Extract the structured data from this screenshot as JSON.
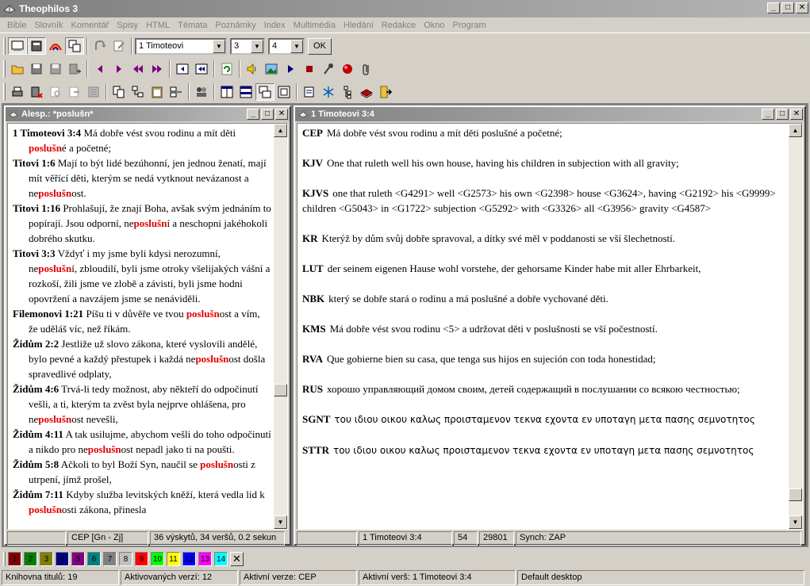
{
  "window": {
    "title": "Theophilos 3"
  },
  "menu": [
    "Bible",
    "Slovník",
    "Komentář",
    "Spisy",
    "HTML",
    "Témata",
    "Poznámky",
    "Index",
    "Multimédia",
    "Hledání",
    "Redakce",
    "Okno",
    "Program"
  ],
  "toolbar": {
    "book_select": "1 Timoteovi",
    "chapter_select": "3",
    "verse_select": "4",
    "ok_label": "OK"
  },
  "search_window": {
    "title": "Alesp.: *poslušn*",
    "results": [
      {
        "ref": "1 Timoteovi 3:4",
        "parts": [
          "  Má dobře vést svou rodinu a mít děti ",
          "poslušn",
          "é a početné;"
        ]
      },
      {
        "ref": "Titovi 1:6",
        "parts": [
          "  Mají to být lidé bezúhonní, jen jednou ženatí, mají mít věřící děti, kterým se nedá vytknout nevázanost a ne",
          "poslušn",
          "ost."
        ]
      },
      {
        "ref": "Titovi 1:16",
        "parts": [
          "  Prohlašují, že znají Boha, avšak svým jednáním to popírají. Jsou odporní, ne",
          "poslušn",
          "í a neschopni jakéhokoli dobrého skutku."
        ]
      },
      {
        "ref": "Titovi 3:3",
        "parts": [
          "  Vždyť i my jsme byli kdysi nerozumní, ne",
          "poslušn",
          "í, zbloudilí, byli jsme otroky všelijakých vášní a rozkoší, žili jsme ve zlobě a závisti, byli jsme hodni opovržení a navzájem jsme se nenáviděli."
        ]
      },
      {
        "ref": "Filemonovi 1:21",
        "parts": [
          "  Píšu ti v důvěře ve tvou ",
          "poslušn",
          "ost a vím, že uděláš víc, než říkám."
        ]
      },
      {
        "ref": "Židům 2:2",
        "parts": [
          "  Jestliže už slovo zákona, které vyslovili andělé, bylo pevné a každý přestupek i každá ne",
          "poslušn",
          "ost došla spravedlivé odplaty,"
        ]
      },
      {
        "ref": "Židům 4:6",
        "parts": [
          "  Trvá-li tedy možnost, aby někteří do odpočinutí vešli, a ti, kterým ta zvěst byla nejprve ohlášena, pro ne",
          "poslušn",
          "ost nevešli,"
        ]
      },
      {
        "ref": "Židům 4:11",
        "parts": [
          "  A tak usilujme, abychom vešli do toho odpočinutí a nikdo pro ne",
          "poslušn",
          "ost nepadl jako ti na poušti."
        ]
      },
      {
        "ref": "Židům 5:8",
        "parts": [
          "  Ačkoli to byl Boží Syn, naučil se ",
          "poslušn",
          "osti z utrpení, jímž prošel,"
        ]
      },
      {
        "ref": "Židům 7:11",
        "parts": [
          "  Kdyby služba levitských kněží, která vedla lid k ",
          "poslušn",
          "osti zákona, přinesla"
        ]
      }
    ],
    "status": [
      "",
      "CEP [Gn - Zj]",
      "36 výskytů, 34 veršů, 0.2 sekun"
    ]
  },
  "verse_window": {
    "title": "1 Timoteovi 3:4",
    "verses": [
      {
        "tr": "CEP",
        "txt": "Má dobře vést svou rodinu a mít děti poslušné a početné;"
      },
      {
        "tr": "KJV",
        "txt": "One that ruleth well his own house, having his children in subjection with all gravity;"
      },
      {
        "tr": "KJVS",
        "txt": "one that ruleth <G4291> well <G2573> his own <G2398> house <G3624>, having <G2192> his <G9999> children <G5043> in <G1722> subjection <G5292> with <G3326> all <G3956> gravity <G4587>"
      },
      {
        "tr": "KR",
        "txt": "Kterýž by dům svůj dobře spravoval, a dítky své měl v poddanosti se vší šlechetností."
      },
      {
        "tr": "LUT",
        "txt": "der seinem eigenen Hause wohl vorstehe, der gehorsame Kinder habe mit aller Ehrbarkeit,"
      },
      {
        "tr": "NBK",
        "txt": "který se dobře stará o rodinu a má poslušné a dobře vychované děti."
      },
      {
        "tr": "KMS",
        "txt": "Má dobře vést svou rodinu <5> a udržovat děti v poslušnosti se vší počestností."
      },
      {
        "tr": "RVA",
        "txt": "Que gobierne bien su casa, que tenga sus hijos en sujeción con toda honestidad;"
      },
      {
        "tr": "RUS",
        "txt": "хорошо управляющий домом своим, детей содержащий в послушании со всякою честностью;"
      },
      {
        "tr": "SGNT",
        "txt": "του ιδιου οικου καλως προισταμενον τεκνα εχοντα εν υποταγη μετα πασης σεμνοτητος"
      },
      {
        "tr": "STTR",
        "txt": "του ιδιου οικου καλως προισταμενον τεκνα εχοντα εν υποταγη μετα πασης σεμνοτητος"
      }
    ],
    "status": [
      "",
      "1 Timoteovi 3:4",
      "54",
      "29801",
      "Synch: ZAP"
    ]
  },
  "colorbar": {
    "items": [
      {
        "label": "1",
        "color": "#800000"
      },
      {
        "label": "2",
        "color": "#008000"
      },
      {
        "label": "3",
        "color": "#808000"
      },
      {
        "label": "4",
        "color": "#000080"
      },
      {
        "label": "5",
        "color": "#800080"
      },
      {
        "label": "6",
        "color": "#008080"
      },
      {
        "label": "7",
        "color": "#808080"
      },
      {
        "label": "8",
        "color": "#c0c0c0"
      },
      {
        "label": "9",
        "color": "#ff0000"
      },
      {
        "label": "10",
        "color": "#00ff00"
      },
      {
        "label": "11",
        "color": "#ffff00"
      },
      {
        "label": "12",
        "color": "#0000ff"
      },
      {
        "label": "13",
        "color": "#ff00ff"
      },
      {
        "label": "14",
        "color": "#00ffff"
      }
    ],
    "close": "✕"
  },
  "statusbar": [
    "Knihovna titulů: 19",
    "Aktivovaných verzí: 12",
    "Aktivní verze: CEP",
    "Aktivní verš: 1 Timoteovi 3:4",
    "Default desktop"
  ],
  "colors": {
    "highlight": "#e00000",
    "title_inactive": "#808080"
  }
}
